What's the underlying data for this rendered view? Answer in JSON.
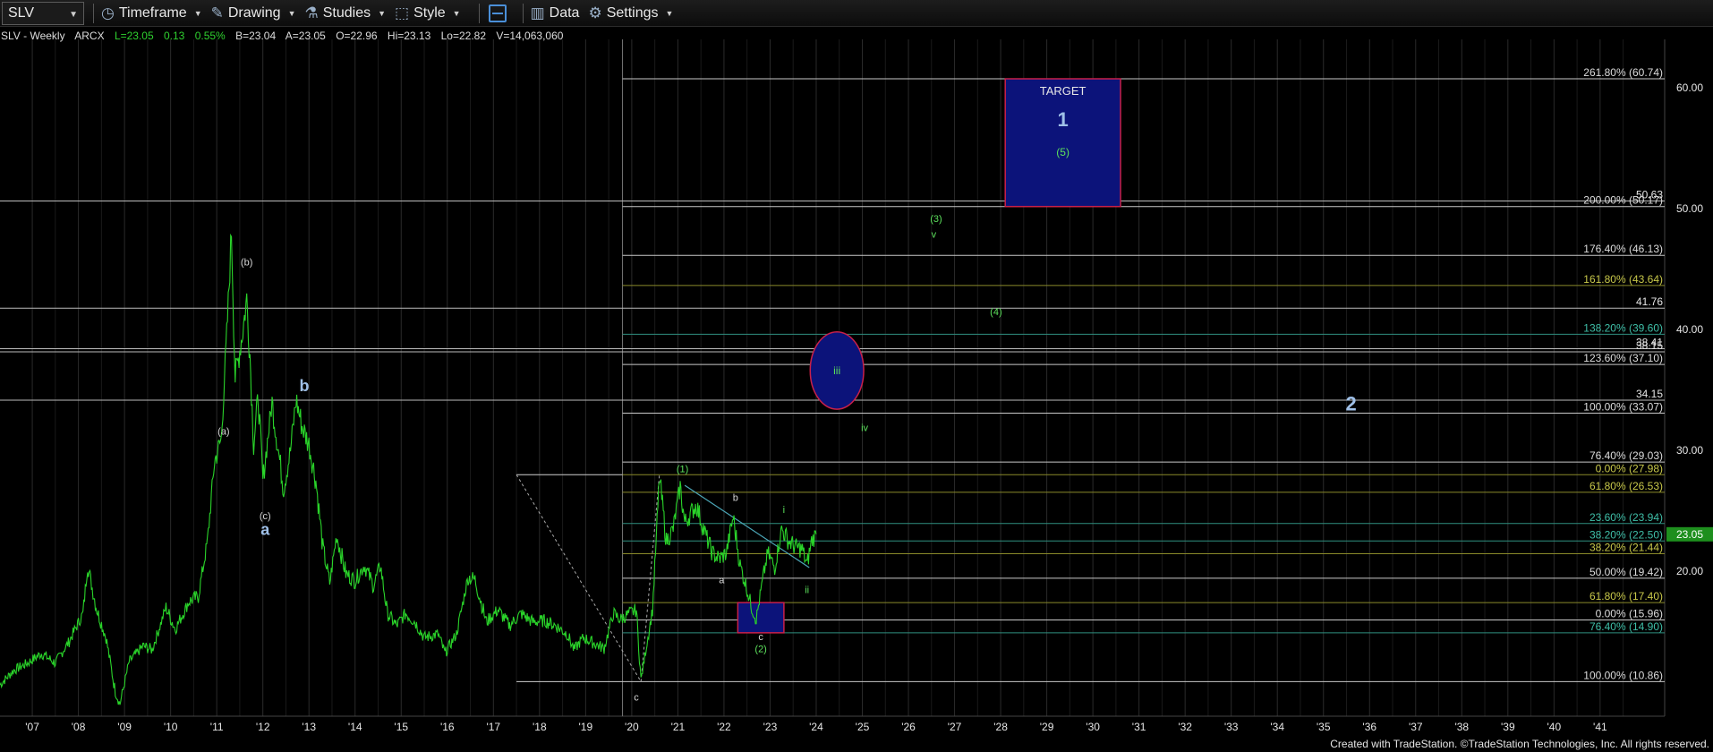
{
  "toolbar": {
    "symbol": "SLV",
    "timeframe_label": "Timeframe",
    "drawing_label": "Drawing",
    "studies_label": "Studies",
    "style_label": "Style",
    "data_label": "Data",
    "settings_label": "Settings"
  },
  "infobar": {
    "title": "SLV - Weekly",
    "exchange": "ARCX",
    "last": "L=23.05",
    "change": "0.13",
    "change_pct": "0.55%",
    "bid": "B=23.04",
    "ask": "A=23.05",
    "open": "O=22.96",
    "high": "Hi=23.13",
    "low": "Lo=22.82",
    "volume": "V=14,063,060"
  },
  "footer": {
    "credit": "Created with TradeStation. ©TradeStation Technologies, Inc. All rights reserved."
  },
  "colors": {
    "price": "#2ad42a",
    "grid": "#2a2a2a",
    "fib_white": "#c8c8c8",
    "fib_teal": "#2f8f80",
    "fib_olive": "#8a8a2a",
    "box_fill": "#0c137a",
    "box_stroke": "#c8204a",
    "wave_green": "#5ce05c",
    "wave_blue": "#9fc0e8",
    "last_price_bg": "#1e8f1e"
  },
  "chart_data": {
    "type": "line",
    "symbol": "SLV",
    "interval": "Weekly",
    "x_ticks": [
      "'07",
      "'08",
      "'09",
      "'10",
      "'11",
      "'12",
      "'13",
      "'14",
      "'15",
      "'16",
      "'17",
      "'18",
      "'19",
      "'20",
      "'21",
      "'22",
      "'23",
      "'24",
      "'25",
      "'26",
      "'27",
      "'28",
      "'29",
      "'30",
      "'31",
      "'32",
      "'33",
      "'34",
      "'35",
      "'36",
      "'37",
      "'38",
      "'39",
      "'40",
      "'41"
    ],
    "x_tick_years": [
      2007,
      2008,
      2009,
      2010,
      2011,
      2012,
      2013,
      2014,
      2015,
      2016,
      2017,
      2018,
      2019,
      2020,
      2021,
      2022,
      2023,
      2024,
      2025,
      2026,
      2027,
      2028,
      2029,
      2030,
      2031,
      2032,
      2033,
      2034,
      2035,
      2036,
      2037,
      2038,
      2039,
      2040,
      2041
    ],
    "y_ticks": [
      20,
      30,
      40,
      50,
      60
    ],
    "y_tick_labels": [
      "20.00",
      "30.00",
      "40.00",
      "50.00",
      "60.00"
    ],
    "last_price": 23.05,
    "last_price_label": "23.05",
    "price_series": [
      [
        2006.3,
        10.6
      ],
      [
        2006.6,
        11.8
      ],
      [
        2006.9,
        12.4
      ],
      [
        2007.2,
        13.2
      ],
      [
        2007.5,
        12.4
      ],
      [
        2007.8,
        14.2
      ],
      [
        2008.1,
        16.5
      ],
      [
        2008.2,
        20.5
      ],
      [
        2008.4,
        16.8
      ],
      [
        2008.6,
        14.5
      ],
      [
        2008.8,
        10.0
      ],
      [
        2008.9,
        9.0
      ],
      [
        2009.1,
        12.5
      ],
      [
        2009.4,
        13.8
      ],
      [
        2009.6,
        13.5
      ],
      [
        2009.9,
        17.0
      ],
      [
        2010.1,
        15.2
      ],
      [
        2010.4,
        17.5
      ],
      [
        2010.6,
        17.9
      ],
      [
        2010.8,
        22.5
      ],
      [
        2010.95,
        29.0
      ],
      [
        2011.1,
        31.0
      ],
      [
        2011.25,
        42.0
      ],
      [
        2011.32,
        48.2
      ],
      [
        2011.4,
        36.0
      ],
      [
        2011.55,
        39.5
      ],
      [
        2011.65,
        42.5
      ],
      [
        2011.72,
        38.0
      ],
      [
        2011.8,
        30.5
      ],
      [
        2011.9,
        34.5
      ],
      [
        2012.0,
        27.5
      ],
      [
        2012.2,
        34.0
      ],
      [
        2012.3,
        31.0
      ],
      [
        2012.45,
        26.8
      ],
      [
        2012.6,
        30.0
      ],
      [
        2012.72,
        34.2
      ],
      [
        2012.85,
        32.0
      ],
      [
        2013.0,
        30.5
      ],
      [
        2013.15,
        27.5
      ],
      [
        2013.3,
        22.0
      ],
      [
        2013.45,
        19.0
      ],
      [
        2013.6,
        23.0
      ],
      [
        2013.8,
        19.8
      ],
      [
        2014.0,
        19.2
      ],
      [
        2014.2,
        20.5
      ],
      [
        2014.4,
        18.8
      ],
      [
        2014.55,
        20.5
      ],
      [
        2014.7,
        16.5
      ],
      [
        2014.9,
        15.5
      ],
      [
        2015.1,
        16.5
      ],
      [
        2015.3,
        15.8
      ],
      [
        2015.5,
        14.5
      ],
      [
        2015.8,
        14.8
      ],
      [
        2015.95,
        13.2
      ],
      [
        2016.2,
        14.8
      ],
      [
        2016.45,
        19.5
      ],
      [
        2016.6,
        19.3
      ],
      [
        2016.85,
        15.8
      ],
      [
        2017.1,
        16.8
      ],
      [
        2017.35,
        15.5
      ],
      [
        2017.6,
        16.5
      ],
      [
        2017.85,
        15.8
      ],
      [
        2018.1,
        15.9
      ],
      [
        2018.35,
        15.5
      ],
      [
        2018.6,
        14.8
      ],
      [
        2018.75,
        13.5
      ],
      [
        2018.95,
        14.5
      ],
      [
        2019.2,
        14.0
      ],
      [
        2019.4,
        13.6
      ],
      [
        2019.6,
        16.5
      ],
      [
        2019.75,
        16.0
      ],
      [
        2019.95,
        16.5
      ],
      [
        2020.1,
        16.8
      ],
      [
        2020.2,
        11.0
      ],
      [
        2020.35,
        14.5
      ],
      [
        2020.45,
        16.8
      ],
      [
        2020.55,
        24.0
      ],
      [
        2020.6,
        27.8
      ],
      [
        2020.75,
        22.5
      ],
      [
        2020.9,
        23.5
      ],
      [
        2021.05,
        27.0
      ],
      [
        2021.15,
        24.0
      ],
      [
        2021.4,
        25.5
      ],
      [
        2021.6,
        23.0
      ],
      [
        2021.75,
        21.5
      ],
      [
        2021.9,
        21.0
      ],
      [
        2022.05,
        21.5
      ],
      [
        2022.2,
        24.5
      ],
      [
        2022.35,
        20.5
      ],
      [
        2022.5,
        18.5
      ],
      [
        2022.6,
        17.0
      ],
      [
        2022.7,
        16.0
      ],
      [
        2022.85,
        19.5
      ],
      [
        2022.95,
        21.5
      ],
      [
        2023.1,
        20.3
      ],
      [
        2023.25,
        23.5
      ],
      [
        2023.4,
        22.5
      ],
      [
        2023.55,
        22.0
      ],
      [
        2023.7,
        21.8
      ],
      [
        2023.8,
        20.5
      ],
      [
        2023.9,
        22.5
      ],
      [
        2024.0,
        23.05
      ]
    ],
    "fib_levels": [
      {
        "label": "261.80% (60.74)",
        "value": 60.74,
        "color": "white"
      },
      {
        "label": "200.00% (50.17)",
        "value": 50.17,
        "color": "white"
      },
      {
        "label": "176.40% (46.13)",
        "value": 46.13,
        "color": "white"
      },
      {
        "label": "161.80% (43.64)",
        "value": 43.64,
        "color": "olive"
      },
      {
        "label": "138.20% (39.60)",
        "value": 39.6,
        "color": "teal"
      },
      {
        "label": "123.60% (37.10)",
        "value": 37.1,
        "color": "white"
      },
      {
        "label": "100.00% (33.07)",
        "value": 33.07,
        "color": "white"
      },
      {
        "label": "76.40% (29.03)",
        "value": 29.03,
        "color": "white"
      },
      {
        "label": "0.00% (27.98)",
        "value": 27.98,
        "color": "olive"
      },
      {
        "label": "61.80% (26.53)",
        "value": 26.53,
        "color": "olive"
      },
      {
        "label": "23.60% (23.94)",
        "value": 23.94,
        "color": "teal"
      },
      {
        "label": "38.20% (22.50)",
        "value": 22.5,
        "color": "teal"
      },
      {
        "label": "38.20% (21.44)",
        "value": 21.44,
        "color": "olive"
      },
      {
        "label": "50.00% (19.42)",
        "value": 19.42,
        "color": "white"
      },
      {
        "label": "61.80% (17.40)",
        "value": 17.4,
        "color": "olive"
      },
      {
        "label": "0.00% (15.96)",
        "value": 15.96,
        "color": "white"
      },
      {
        "label": "76.40% (14.90)",
        "value": 14.9,
        "color": "teal"
      },
      {
        "label": "100.00% (10.86)",
        "value": 10.86,
        "color": "white"
      }
    ],
    "horizontal_lines": [
      {
        "label": "50.63",
        "value": 50.63
      },
      {
        "label": "41.76",
        "value": 41.76
      },
      {
        "label": "38.41",
        "value": 38.41
      },
      {
        "label": "38.15",
        "value": 38.15
      },
      {
        "label": "34.15",
        "value": 34.15
      }
    ],
    "target_box": {
      "label": "TARGET",
      "wave": "1",
      "subwave": "(5)",
      "x_start": 2028.1,
      "x_end": 2030.6,
      "y_low": 50.17,
      "y_high": 60.74
    },
    "support_box": {
      "x_start": 2022.3,
      "x_end": 2023.3,
      "y_low": 14.9,
      "y_high": 17.4
    },
    "ellipse": {
      "label": "iii",
      "x_center": 2024.45,
      "y_center": 36.6,
      "x_radius": 0.58,
      "y_radius": 3.2
    },
    "wave_labels": [
      {
        "text": "(b)",
        "x": 2011.65,
        "y": 45.3,
        "group": "white"
      },
      {
        "text": "(a)",
        "x": 2011.15,
        "y": 31.3,
        "group": "white"
      },
      {
        "text": "(c)",
        "x": 2012.05,
        "y": 24.3,
        "group": "white"
      },
      {
        "text": "a",
        "x": 2012.05,
        "y": 23.0,
        "group": "blue"
      },
      {
        "text": "b",
        "x": 2012.9,
        "y": 34.9,
        "group": "blue"
      },
      {
        "text": "c",
        "x": 2020.1,
        "y": 9.3,
        "group": "white"
      },
      {
        "text": "(1)",
        "x": 2021.1,
        "y": 28.2,
        "group": "green"
      },
      {
        "text": "b",
        "x": 2022.25,
        "y": 25.8,
        "group": "white"
      },
      {
        "text": "a",
        "x": 2021.95,
        "y": 19.0,
        "group": "white"
      },
      {
        "text": "c",
        "x": 2022.8,
        "y": 14.3,
        "group": "white"
      },
      {
        "text": "(2)",
        "x": 2022.8,
        "y": 13.3,
        "group": "green"
      },
      {
        "text": "i",
        "x": 2023.3,
        "y": 24.8,
        "group": "green"
      },
      {
        "text": "ii",
        "x": 2023.8,
        "y": 18.2,
        "group": "green"
      },
      {
        "text": "iv",
        "x": 2025.05,
        "y": 31.6,
        "group": "green"
      },
      {
        "text": "(3)",
        "x": 2026.6,
        "y": 48.9,
        "group": "green"
      },
      {
        "text": "v",
        "x": 2026.55,
        "y": 47.6,
        "group": "green"
      },
      {
        "text": "(4)",
        "x": 2027.9,
        "y": 41.2,
        "group": "green"
      },
      {
        "text": "2",
        "x": 2035.6,
        "y": 33.3,
        "group": "blue"
      }
    ],
    "ylim": [
      8,
      64
    ],
    "xlim": [
      2006.3,
      2042.4
    ]
  }
}
